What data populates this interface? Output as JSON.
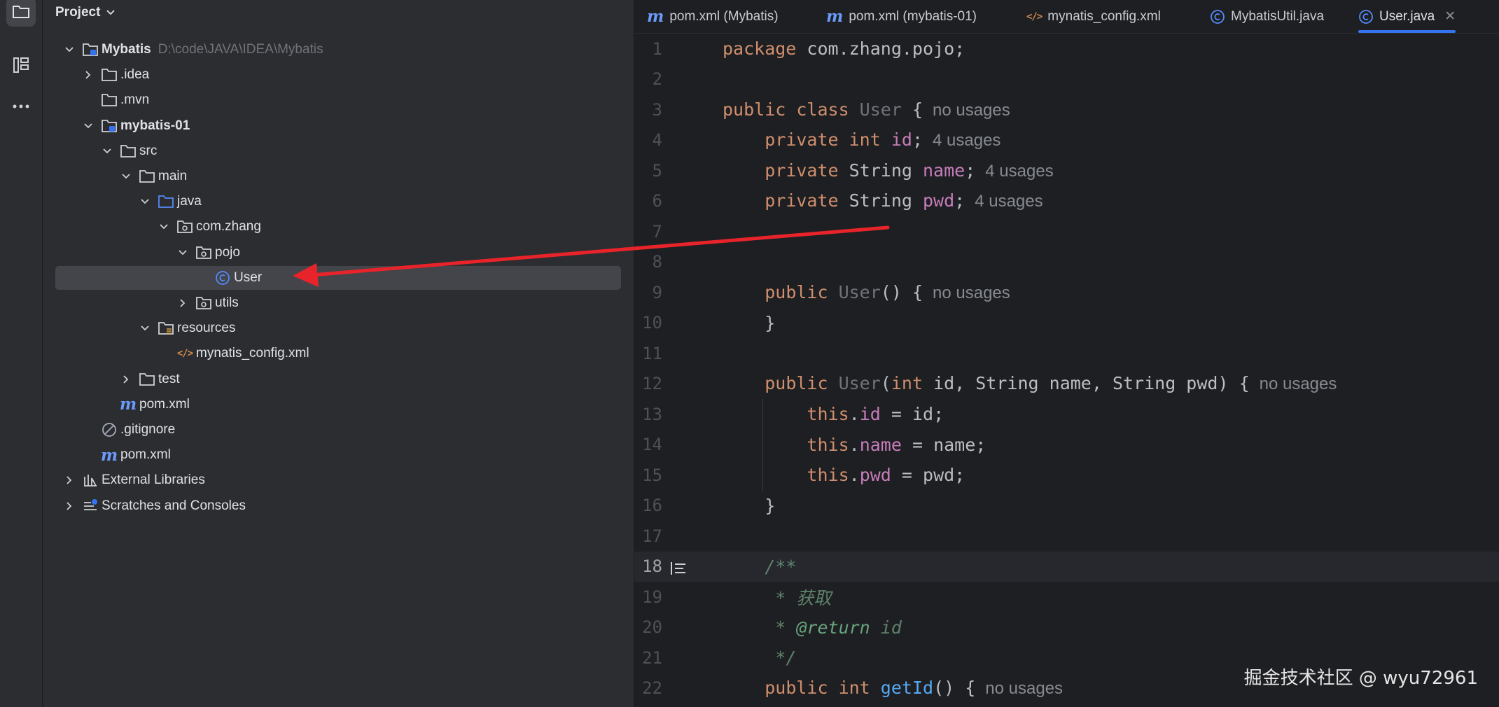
{
  "project_panel": {
    "title": "Project",
    "tree": [
      {
        "id": "mybatis",
        "label": "Mybatis",
        "path": "D:\\code\\JAVA\\IDEA\\Mybatis",
        "bold": true,
        "depth": 0,
        "chevron": "down",
        "icon": "module-folder-icon"
      },
      {
        "id": "idea",
        "label": ".idea",
        "depth": 1,
        "chevron": "right",
        "icon": "folder-icon"
      },
      {
        "id": "mvn",
        "label": ".mvn",
        "depth": 1,
        "chevron": "none",
        "icon": "folder-icon"
      },
      {
        "id": "mybatis01",
        "label": "mybatis-01",
        "bold": true,
        "depth": 1,
        "chevron": "down",
        "icon": "module-folder-icon"
      },
      {
        "id": "src",
        "label": "src",
        "depth": 2,
        "chevron": "down",
        "icon": "folder-icon"
      },
      {
        "id": "main",
        "label": "main",
        "depth": 3,
        "chevron": "down",
        "icon": "folder-icon"
      },
      {
        "id": "java",
        "label": "java",
        "depth": 4,
        "chevron": "down",
        "icon": "source-folder-icon"
      },
      {
        "id": "comzhang",
        "label": "com.zhang",
        "depth": 5,
        "chevron": "down",
        "icon": "package-icon"
      },
      {
        "id": "pojo",
        "label": "pojo",
        "depth": 6,
        "chevron": "down",
        "icon": "package-icon"
      },
      {
        "id": "user",
        "label": "User",
        "depth": 7,
        "chevron": "none",
        "icon": "java-class-icon",
        "selected": true
      },
      {
        "id": "utils",
        "label": "utils",
        "depth": 6,
        "chevron": "right",
        "icon": "package-icon"
      },
      {
        "id": "resources",
        "label": "resources",
        "depth": 4,
        "chevron": "down",
        "icon": "resources-folder-icon"
      },
      {
        "id": "mynatisconfig",
        "label": "mynatis_config.xml",
        "depth": 5,
        "chevron": "none",
        "icon": "xml-file-icon"
      },
      {
        "id": "test",
        "label": "test",
        "depth": 3,
        "chevron": "right",
        "icon": "folder-icon"
      },
      {
        "id": "pomsub",
        "label": "pom.xml",
        "depth": 2,
        "chevron": "none",
        "icon": "maven-icon"
      },
      {
        "id": "gitignore",
        "label": ".gitignore",
        "depth": 1,
        "chevron": "none",
        "icon": "ignore-file-icon"
      },
      {
        "id": "pomroot",
        "label": "pom.xml",
        "depth": 1,
        "chevron": "none",
        "icon": "maven-icon"
      },
      {
        "id": "extlibs",
        "label": "External Libraries",
        "depth": 0,
        "chevron": "right",
        "icon": "libraries-icon"
      },
      {
        "id": "scratches",
        "label": "Scratches and Consoles",
        "depth": 0,
        "chevron": "right",
        "icon": "scratches-icon"
      }
    ]
  },
  "editor": {
    "tabs": [
      {
        "label": "pom.xml (Mybatis)",
        "icon": "maven-icon",
        "active": false
      },
      {
        "label": "pom.xml (mybatis-01)",
        "icon": "maven-icon",
        "active": false
      },
      {
        "label": "mynatis_config.xml",
        "icon": "xml-file-icon",
        "active": false
      },
      {
        "label": "MybatisUtil.java",
        "icon": "java-class-icon",
        "active": false
      },
      {
        "label": "User.java",
        "icon": "java-class-icon",
        "active": true,
        "close": "✕"
      }
    ],
    "current_line": 18,
    "lines": [
      {
        "n": 1,
        "segs": [
          [
            "kw",
            "package "
          ],
          [
            "",
            "com.zhang.pojo;"
          ]
        ]
      },
      {
        "n": 2,
        "segs": []
      },
      {
        "n": 3,
        "segs": [
          [
            "kw",
            "public class "
          ],
          [
            "faded",
            "User"
          ],
          [
            "",
            " {"
          ]
        ],
        "hint": "no usages"
      },
      {
        "n": 4,
        "segs": [
          [
            "",
            "    "
          ],
          [
            "kw",
            "private int "
          ],
          [
            "fld",
            "id"
          ],
          [
            "",
            ";"
          ]
        ],
        "hint": "4 usages"
      },
      {
        "n": 5,
        "segs": [
          [
            "",
            "    "
          ],
          [
            "kw",
            "private "
          ],
          [
            "",
            "String "
          ],
          [
            "fld",
            "name"
          ],
          [
            "",
            ";"
          ]
        ],
        "hint": "4 usages"
      },
      {
        "n": 6,
        "segs": [
          [
            "",
            "    "
          ],
          [
            "kw",
            "private "
          ],
          [
            "",
            "String "
          ],
          [
            "fld",
            "pwd"
          ],
          [
            "",
            ";"
          ]
        ],
        "hint": "4 usages"
      },
      {
        "n": 7,
        "segs": []
      },
      {
        "n": 8,
        "segs": []
      },
      {
        "n": 9,
        "segs": [
          [
            "",
            "    "
          ],
          [
            "kw",
            "public "
          ],
          [
            "faded",
            "User"
          ],
          [
            "",
            "() {"
          ]
        ],
        "hint": "no usages"
      },
      {
        "n": 10,
        "segs": [
          [
            "",
            "    }"
          ]
        ]
      },
      {
        "n": 11,
        "segs": []
      },
      {
        "n": 12,
        "segs": [
          [
            "",
            "    "
          ],
          [
            "kw",
            "public "
          ],
          [
            "faded",
            "User"
          ],
          [
            "",
            "("
          ],
          [
            "kw",
            "int "
          ],
          [
            "",
            "id, String name, String pwd) {"
          ]
        ],
        "hint": "no usages"
      },
      {
        "n": 13,
        "segs": [
          [
            "",
            "        "
          ],
          [
            "kw",
            "this"
          ],
          [
            "",
            "."
          ],
          [
            "fld",
            "id"
          ],
          [
            "",
            " = id;"
          ]
        ]
      },
      {
        "n": 14,
        "segs": [
          [
            "",
            "        "
          ],
          [
            "kw",
            "this"
          ],
          [
            "",
            "."
          ],
          [
            "fld",
            "name"
          ],
          [
            "",
            " = name;"
          ]
        ]
      },
      {
        "n": 15,
        "segs": [
          [
            "",
            "        "
          ],
          [
            "kw",
            "this"
          ],
          [
            "",
            "."
          ],
          [
            "fld",
            "pwd"
          ],
          [
            "",
            " = pwd;"
          ]
        ]
      },
      {
        "n": 16,
        "segs": [
          [
            "",
            "    }"
          ]
        ]
      },
      {
        "n": 17,
        "segs": []
      },
      {
        "n": 18,
        "segs": [
          [
            "",
            "    "
          ],
          [
            "com",
            "/**"
          ]
        ]
      },
      {
        "n": 19,
        "segs": [
          [
            "",
            "     "
          ],
          [
            "com",
            "* 获取"
          ]
        ]
      },
      {
        "n": 20,
        "segs": [
          [
            "",
            "     "
          ],
          [
            "com",
            "* "
          ],
          [
            "tag",
            "@return"
          ],
          [
            "com",
            " id"
          ]
        ]
      },
      {
        "n": 21,
        "segs": [
          [
            "",
            "     "
          ],
          [
            "com",
            "*/"
          ]
        ]
      },
      {
        "n": 22,
        "segs": [
          [
            "",
            "    "
          ],
          [
            "kw",
            "public int "
          ],
          [
            "fn",
            "getId"
          ],
          [
            "",
            "() {"
          ]
        ],
        "hint": "no usages"
      }
    ]
  },
  "annotation": {
    "color": "#e8242a"
  },
  "watermark": "掘金技术社区 @ wyu72961",
  "colors": {
    "accent": "#3574f0",
    "panel": "#2b2d30",
    "editor": "#1e1f22"
  }
}
